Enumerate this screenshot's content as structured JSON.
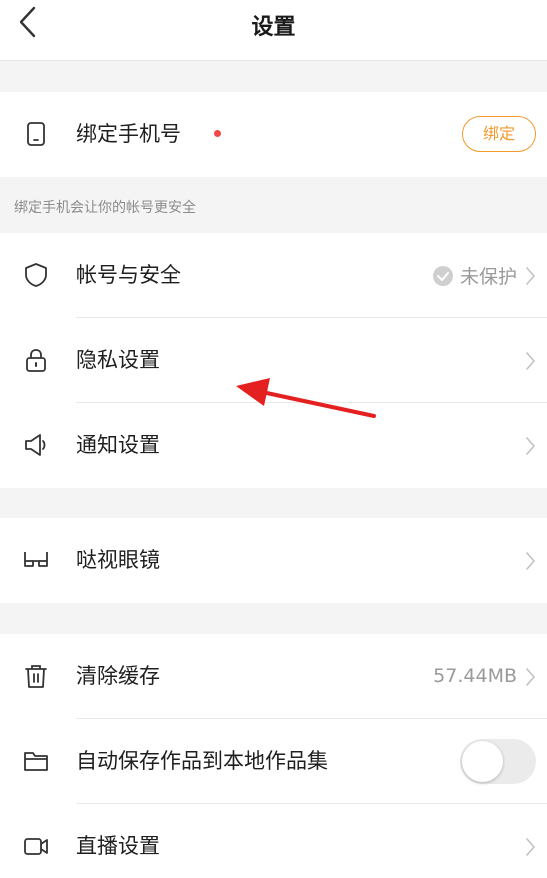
{
  "header": {
    "title": "设置"
  },
  "bind_phone": {
    "label": "绑定手机号",
    "button": "绑定",
    "hint": "绑定手机会让你的帐号更安全"
  },
  "account_group": {
    "items": [
      {
        "label": "帐号与安全",
        "status": "未保护"
      },
      {
        "label": "隐私设置"
      },
      {
        "label": "通知设置"
      }
    ]
  },
  "glasses_group": {
    "items": [
      {
        "label": "哒视眼镜"
      }
    ]
  },
  "misc_group": {
    "items": [
      {
        "label": "清除缓存",
        "value": "57.44MB"
      },
      {
        "label": "自动保存作品到本地作品集",
        "toggle_on": false
      },
      {
        "label": "直播设置"
      }
    ]
  },
  "colors": {
    "accent": "#f39a2e",
    "badge": "#f04848",
    "annotation_arrow": "#e52020"
  }
}
